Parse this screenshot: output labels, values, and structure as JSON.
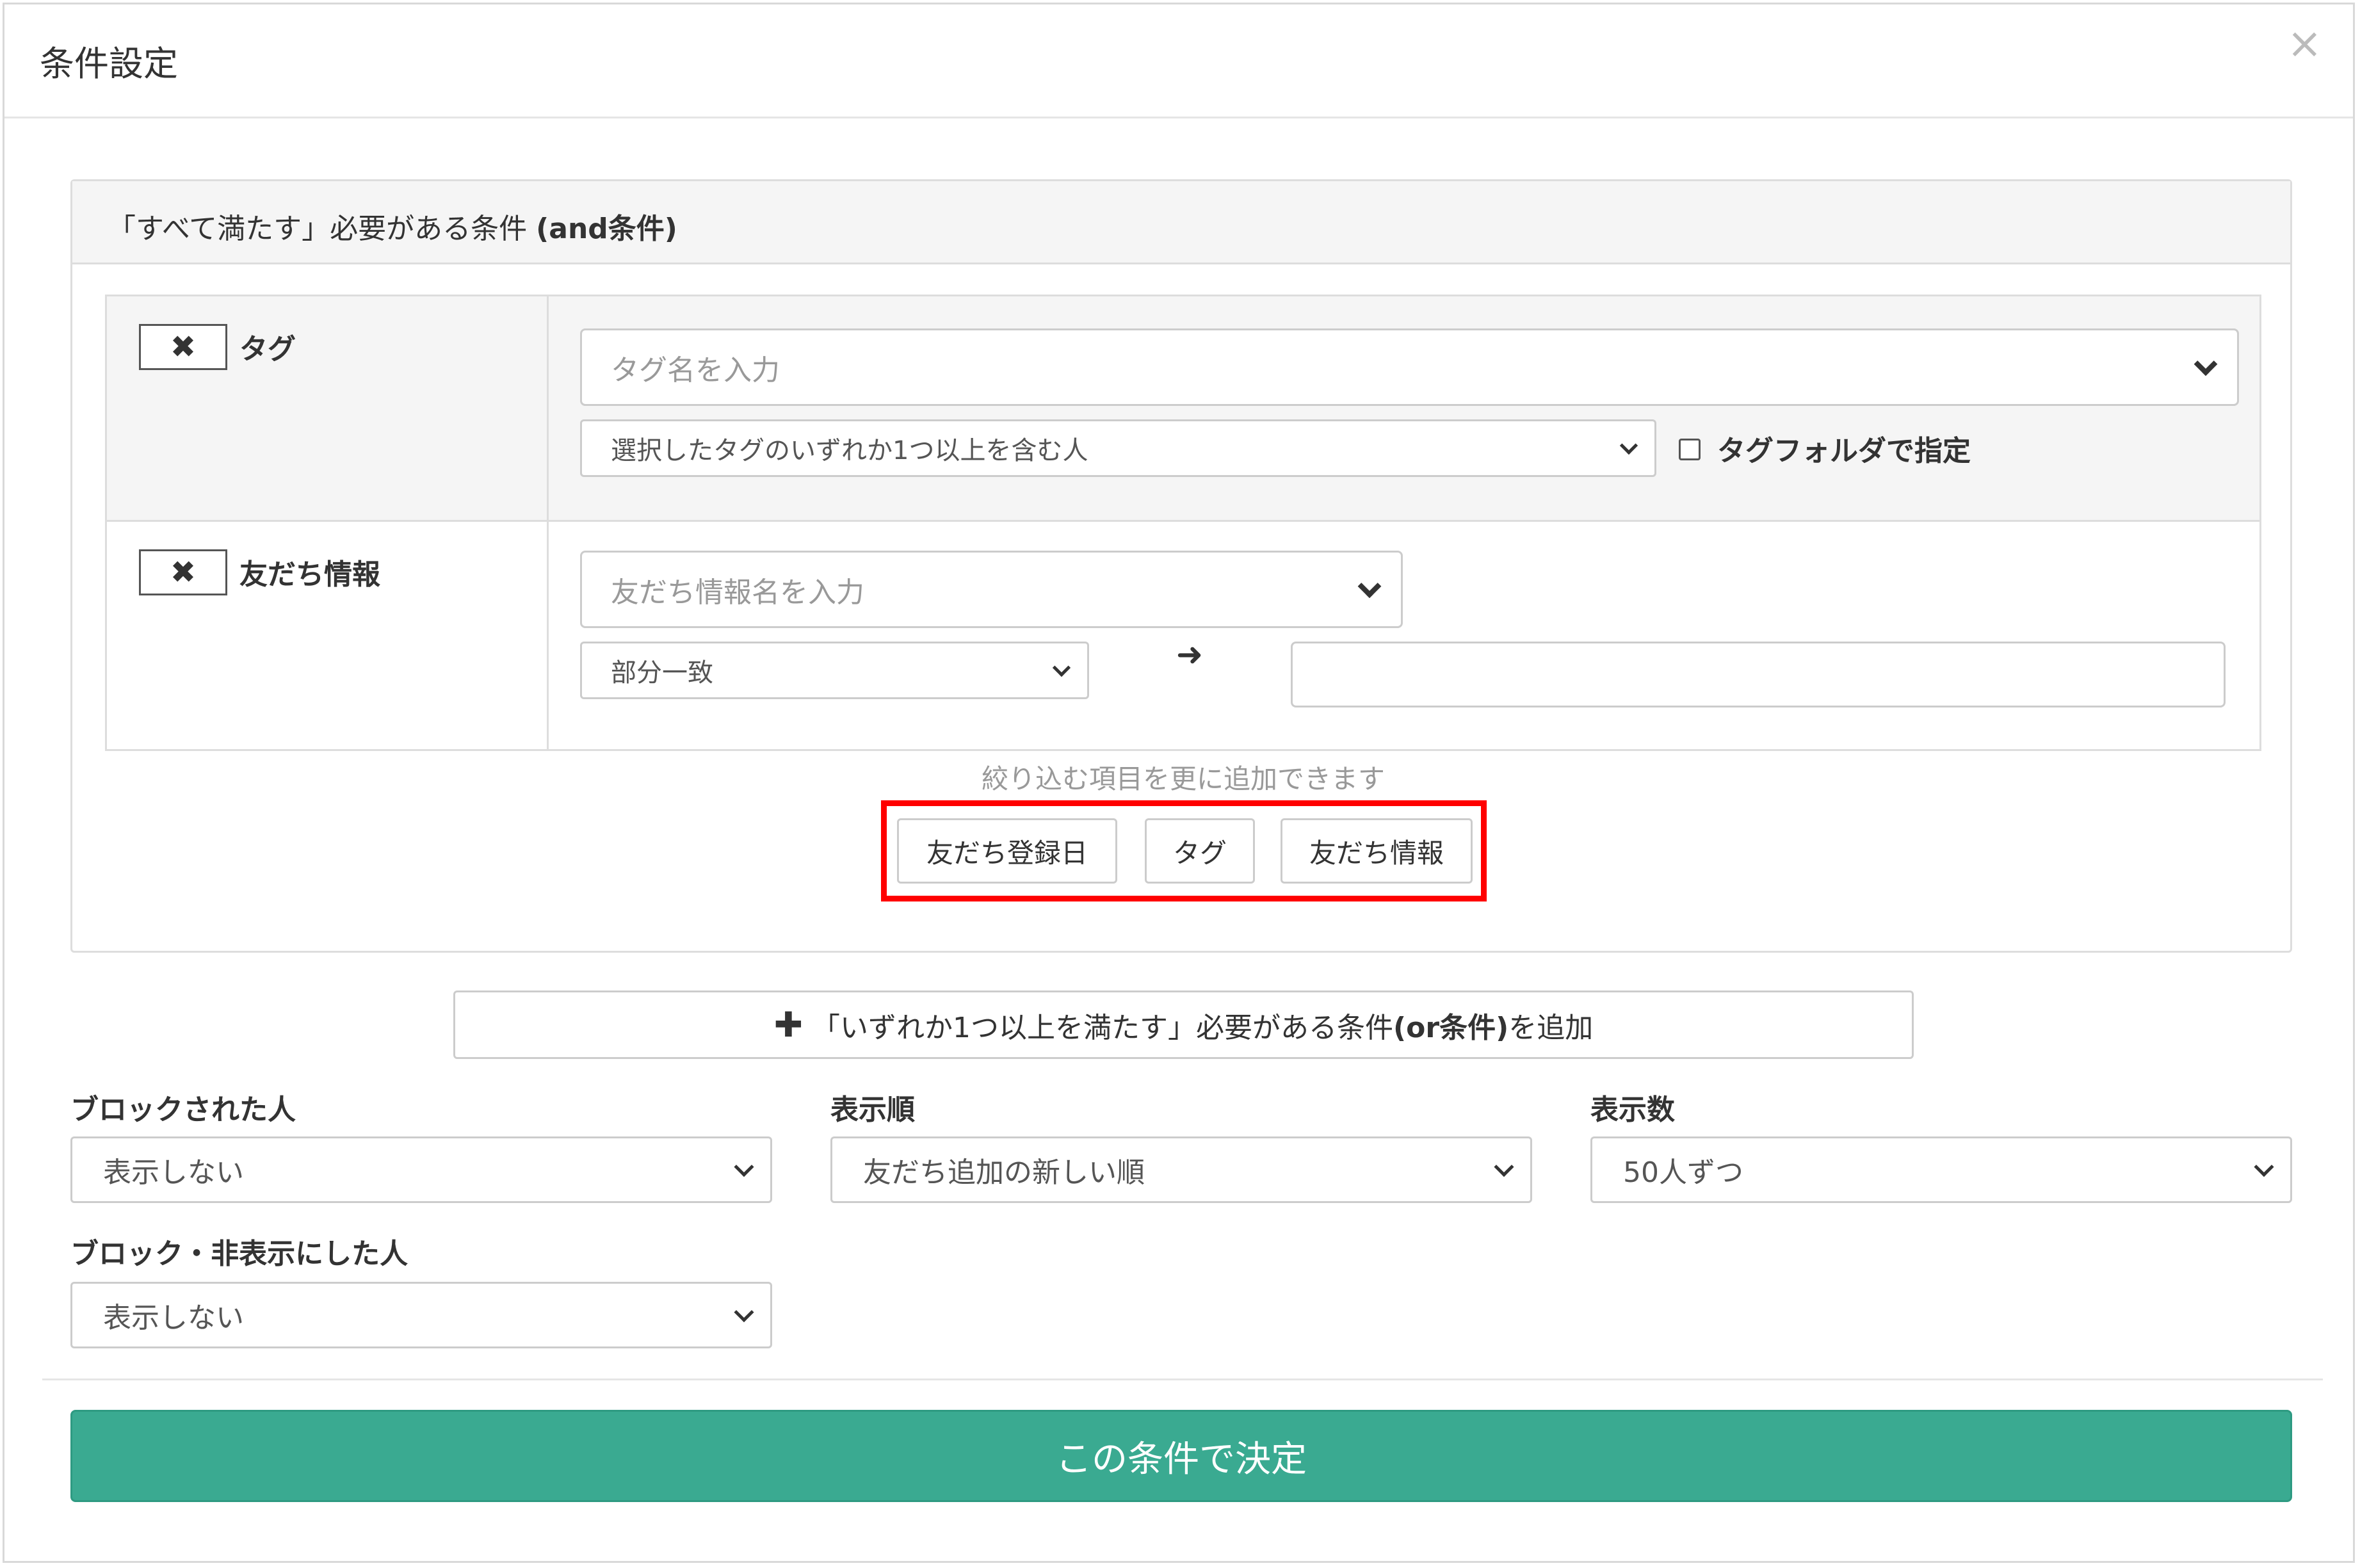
{
  "modal": {
    "title": "条件設定",
    "close_symbol": "×"
  },
  "and_panel": {
    "title_prefix": "「すべて満たす」必要がある条件 ",
    "title_suffix": "(and条件)",
    "remove_symbol": "✖",
    "tag_row": {
      "label": "タグ",
      "search_placeholder": "タグ名を入力",
      "match_select_value": "選択したタグのいずれか1つ以上を含む人",
      "folder_checkbox_label": "タグフォルダで指定",
      "folder_checked": false
    },
    "friend_row": {
      "label": "友だち情報",
      "search_placeholder": "友だち情報名を入力",
      "match_select_value": "部分一致",
      "arrow_symbol": "➜",
      "value": ""
    },
    "hint": "絞り込む項目を更に追加できます",
    "add_buttons": [
      "友だち登録日",
      "タグ",
      "友だち情報"
    ]
  },
  "or_button": {
    "plus_symbol": "✚",
    "label_prefix": "「いずれか1つ以上を満たす」必要がある条件",
    "label_bold": "(or条件)",
    "label_suffix": "を追加"
  },
  "options": {
    "blocked": {
      "label": "ブロックされた人",
      "value": "表示しない"
    },
    "order": {
      "label": "表示順",
      "value": "友だち追加の新しい順"
    },
    "count": {
      "label": "表示数",
      "value": "50人ずつ"
    },
    "blocked_hidden": {
      "label": "ブロック・非表示にした人",
      "value": "表示しない"
    }
  },
  "submit_label": "この条件で決定",
  "colors": {
    "submit_bg": "#3aaa91",
    "highlight_border": "#ff0000"
  }
}
